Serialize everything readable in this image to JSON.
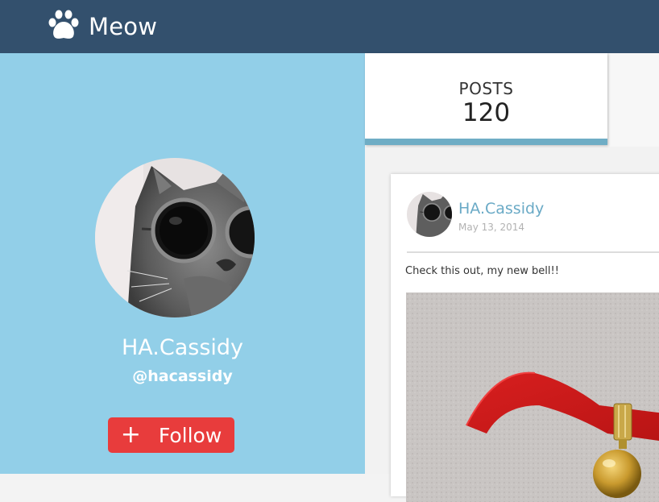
{
  "app": {
    "name": "Meow",
    "logo_icon": "paw-icon"
  },
  "profile": {
    "name": "HA.Cassidy",
    "handle": "@hacassidy",
    "avatar": "cat-with-round-sunglasses-photo",
    "follow": {
      "icon": "plus-icon",
      "icon_glyph": "+",
      "label": "Follow"
    }
  },
  "stats": {
    "posts_label": "POSTS",
    "posts_count": "120"
  },
  "post": {
    "author": "HA.Cassidy",
    "date": "May 13, 2014",
    "text": "Check this out, my new bell!!",
    "image": "red-ribbon-collar-with-bell-photo"
  },
  "colors": {
    "topbar": "#33506d",
    "sidebar": "#92cfe8",
    "follow_button": "#e83c3c",
    "accent": "#6aaac6",
    "posts_underline": "#6fadc5"
  }
}
